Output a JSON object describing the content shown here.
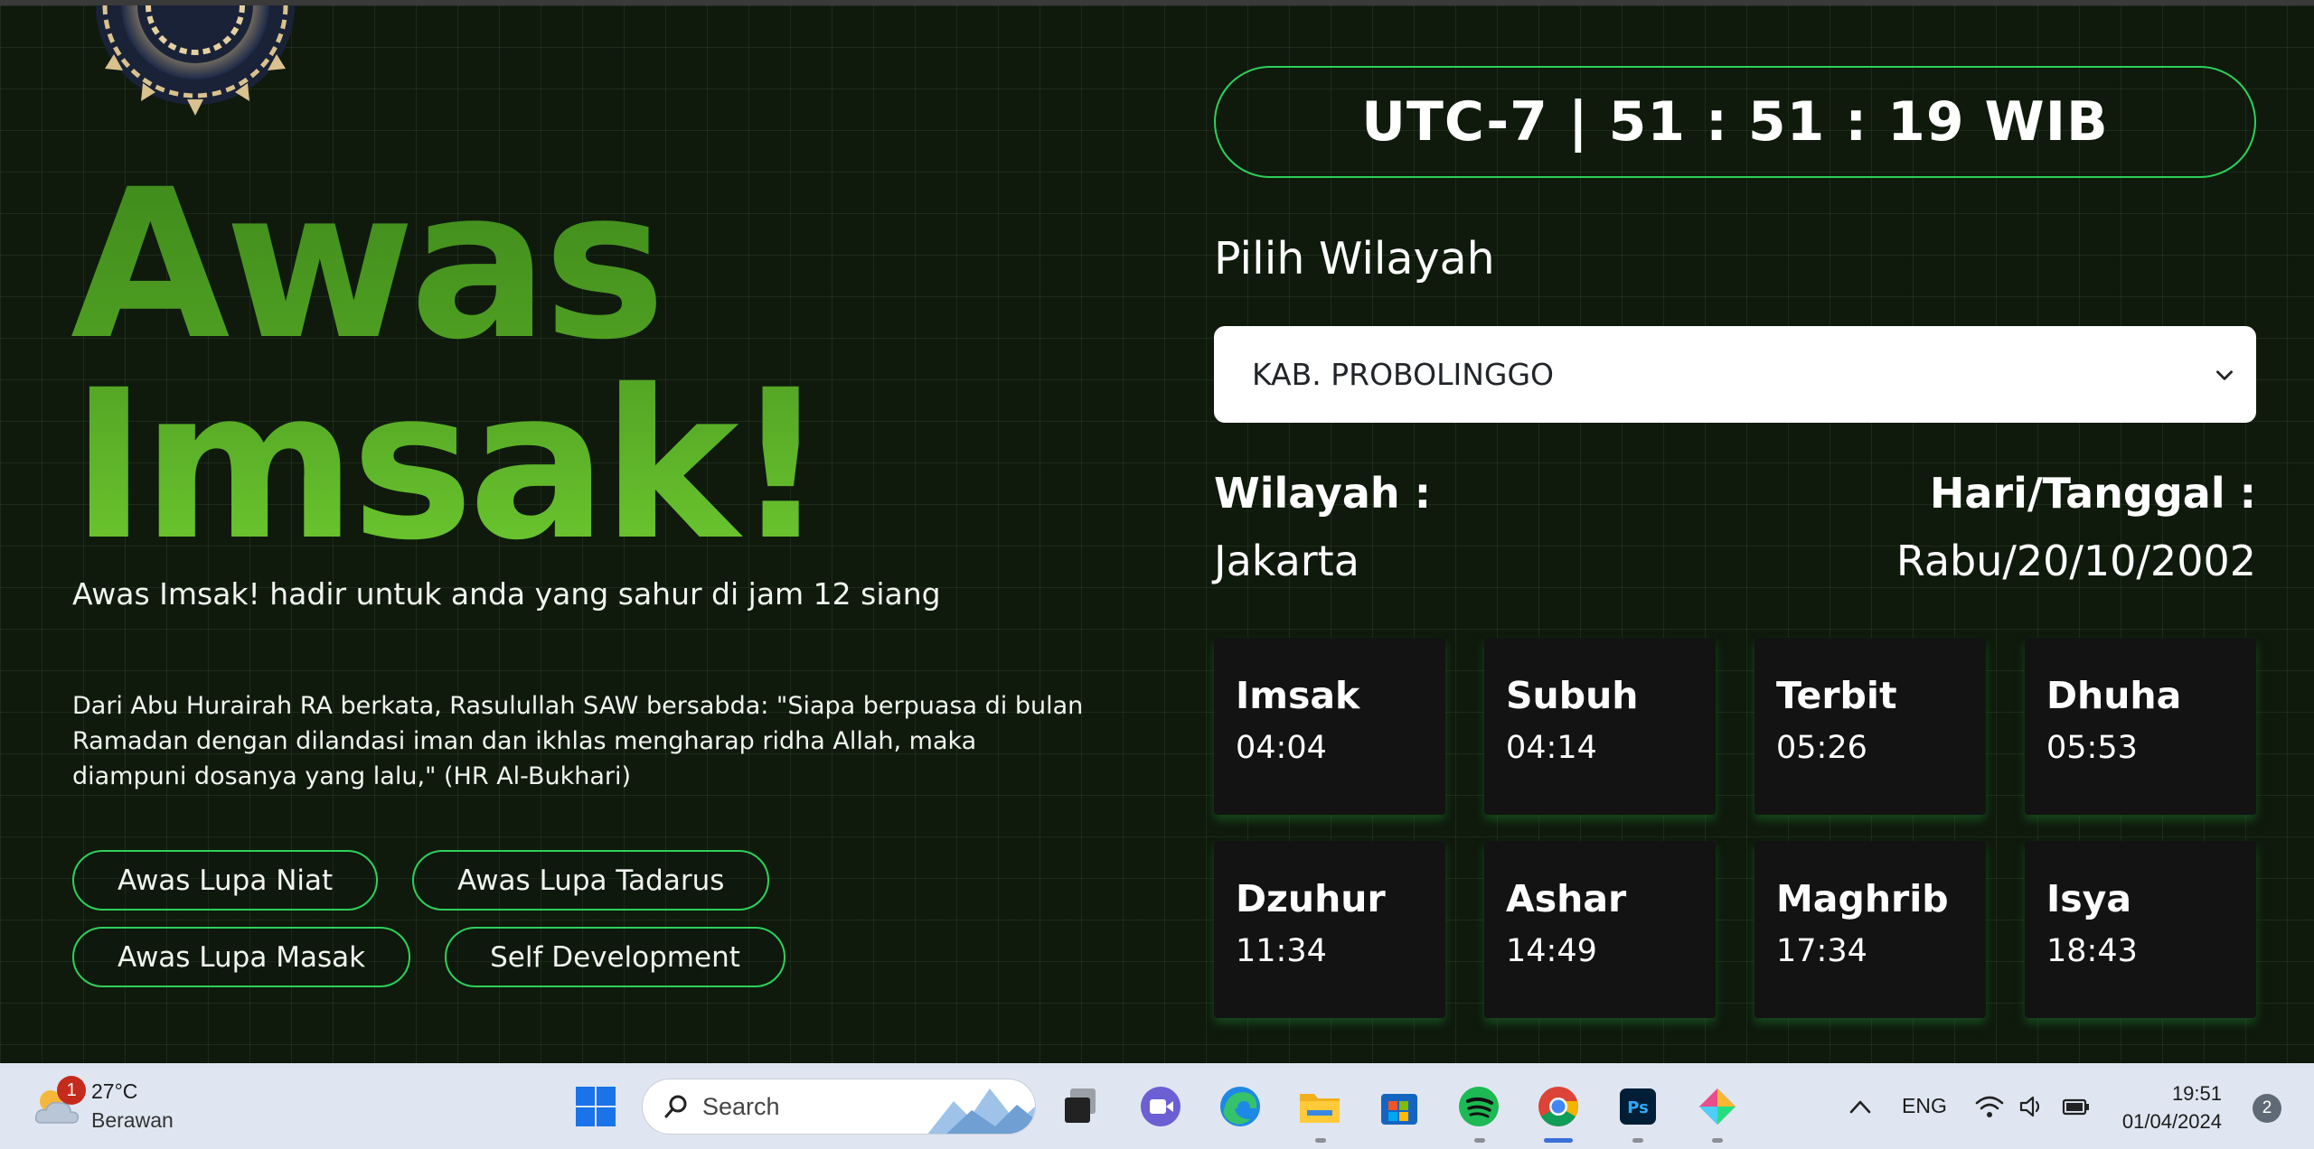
{
  "hero": {
    "line1": "Awas",
    "line2": "Imsak!"
  },
  "tagline": "Awas Imsak! hadir untuk anda yang sahur di jam 12 siang",
  "hadith": "Dari Abu Hurairah RA berkata, Rasulullah SAW bersabda: \"Siapa berpuasa di bulan Ramadan dengan dilandasi iman dan ikhlas mengharap ridha Allah, maka diampuni dosanya yang lalu,\" (HR Al-Bukhari)",
  "buttons": [
    "Awas Lupa Niat",
    "Awas Lupa Tadarus",
    "Awas Lupa Masak",
    "Self Development"
  ],
  "clock": "UTC-7 | 51 : 51 : 19 WIB",
  "region": {
    "label": "Pilih Wilayah",
    "selected": "KAB. PROBOLINGGO",
    "location_label": "Wilayah :",
    "location_value": "Jakarta",
    "date_label": "Hari/Tanggal :",
    "date_value": "Rabu/20/10/2002"
  },
  "prayers": [
    {
      "name": "Imsak",
      "time": "04:04"
    },
    {
      "name": "Subuh",
      "time": "04:14"
    },
    {
      "name": "Terbit",
      "time": "05:26"
    },
    {
      "name": "Dhuha",
      "time": "05:53"
    },
    {
      "name": "Dzuhur",
      "time": "11:34"
    },
    {
      "name": "Ashar",
      "time": "14:49"
    },
    {
      "name": "Maghrib",
      "time": "17:34"
    },
    {
      "name": "Isya",
      "time": "18:43"
    }
  ],
  "colors": {
    "accent": "#2ed05a",
    "hero_top": "#3f8a1c",
    "hero_bottom": "#6cc72f",
    "card_bg": "#131313"
  },
  "taskbar": {
    "weather_badge": "1",
    "temperature": "27°C",
    "condition": "Berawan",
    "search_placeholder": "Search",
    "language": "ENG",
    "time": "19:51",
    "date": "01/04/2024",
    "notification_count": "2",
    "apps": [
      "windows-start-icon",
      "task-view-icon",
      "meet-icon",
      "edge-icon",
      "file-explorer-icon",
      "microsoft-store-icon",
      "spotify-icon",
      "chrome-icon",
      "photoshop-icon",
      "app-icon"
    ]
  }
}
